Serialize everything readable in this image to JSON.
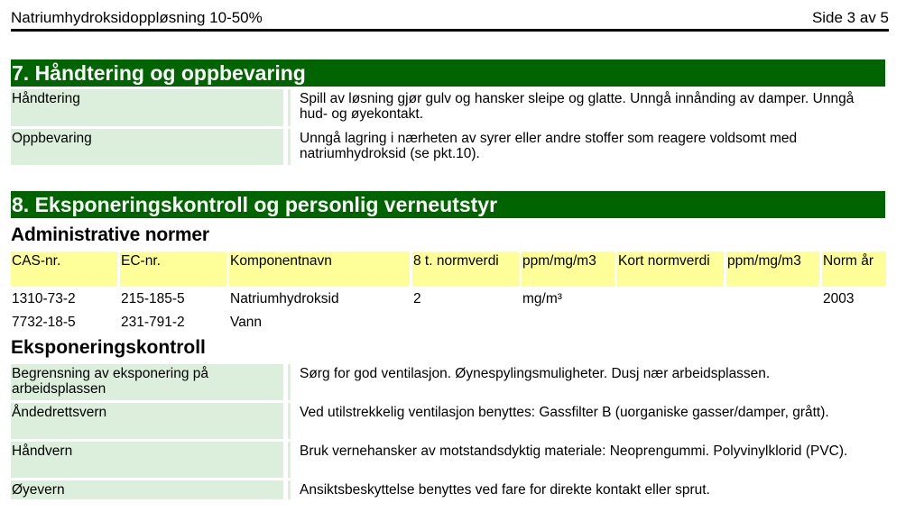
{
  "header": {
    "title": "Natriumhydroksidoppløsning 10-50%",
    "page": "Side 3 av 5"
  },
  "section7": {
    "title": "7. Håndtering og oppbevaring",
    "rows": [
      {
        "label": "Håndtering",
        "text": "Spill av løsning gjør gulv og hansker sleipe og glatte. Unngå innånding av damper. Unngå hud- og øyekontakt."
      },
      {
        "label": "Oppbevaring",
        "text": "Unngå lagring i nærheten av syrer eller andre stoffer som reagere voldsomt med natriumhydroksid (se pkt.10)."
      }
    ]
  },
  "section8": {
    "title": "8. Eksponeringskontroll og personlig verneutstyr",
    "admin_heading": "Administrative normer",
    "table": {
      "headers": [
        "CAS-nr.",
        "EC-nr.",
        "Komponentnavn",
        "8 t. normverdi",
        "ppm/mg/m3",
        "Kort normverdi",
        "ppm/mg/m3",
        "Norm år"
      ],
      "rows": [
        [
          "1310-73-2",
          "215-185-5",
          "Natriumhydroksid",
          "2",
          "mg/m³",
          "",
          "",
          "2003"
        ],
        [
          "7732-18-5",
          "231-791-2",
          "Vann",
          "",
          "",
          "",
          "",
          ""
        ]
      ]
    },
    "exposure_heading": "Eksponeringskontroll",
    "rows": [
      {
        "label": "Begrensning av eksponering på arbeidsplassen",
        "text": "Sørg for god ventilasjon. Øynespylingsmuligheter. Dusj nær arbeidsplassen."
      },
      {
        "label": "Åndedrettsvern",
        "text": "Ved utilstrekkelig ventilasjon benyttes: Gassfilter B (uorganiske gasser/damper, grått)."
      },
      {
        "label": "Håndvern",
        "text": "Bruk vernehansker av motstandsdyktig materiale: Neoprengummi. Polyvinylklorid (PVC)."
      },
      {
        "label": "Øyevern",
        "text": "Ansiktsbeskyttelse benyttes ved fare for direkte kontakt eller sprut."
      }
    ]
  }
}
